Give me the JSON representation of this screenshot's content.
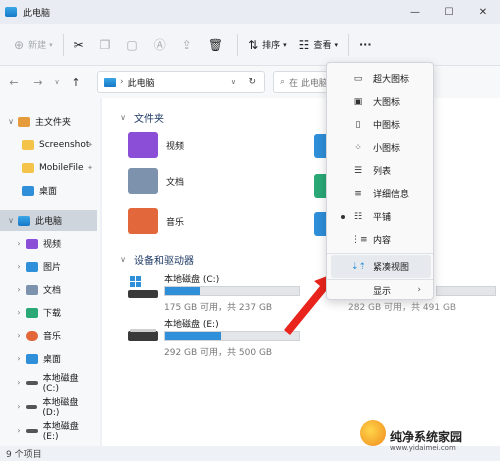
{
  "window": {
    "title": "此电脑"
  },
  "toolbar": {
    "new_label": "新建",
    "sort_label": "排序",
    "view_label": "查看",
    "more_label": "···"
  },
  "address": {
    "path": "此电脑"
  },
  "search": {
    "placeholder": "在 此电脑"
  },
  "sidebar": {
    "items": [
      {
        "label": "主文件夹"
      },
      {
        "label": "Screenshot"
      },
      {
        "label": "MobileFile"
      },
      {
        "label": "桌面"
      },
      {
        "label": "此电脑"
      },
      {
        "label": "视频"
      },
      {
        "label": "图片"
      },
      {
        "label": "文档"
      },
      {
        "label": "下载"
      },
      {
        "label": "音乐"
      },
      {
        "label": "桌面"
      },
      {
        "label": "本地磁盘 (C:)"
      },
      {
        "label": "本地磁盘 (D:)"
      },
      {
        "label": "本地磁盘 (E:)"
      }
    ]
  },
  "content": {
    "folders_title": "文件夹",
    "folders": [
      {
        "label": "视频"
      },
      {
        "label": "文档"
      },
      {
        "label": "音乐"
      }
    ],
    "devices_title": "设备和驱动器",
    "drives": [
      {
        "name": "本地磁盘 (C:)",
        "free": "175 GB 可用，共 237 GB",
        "used_fraction": 0.26
      },
      {
        "name": "本地磁盘 (E:)",
        "free": "292 GB 可用，共 500 GB",
        "used_fraction": 0.42
      }
    ],
    "partial_drive_free": "282 GB 可用，共 491 GB"
  },
  "view_menu": {
    "items": [
      {
        "label": "超大图标"
      },
      {
        "label": "大图标"
      },
      {
        "label": "中图标"
      },
      {
        "label": "小图标"
      },
      {
        "label": "列表"
      },
      {
        "label": "详细信息"
      },
      {
        "label": "平铺"
      },
      {
        "label": "内容"
      },
      {
        "label": "紧凑视图"
      },
      {
        "label": "显示"
      }
    ],
    "selected": "平铺"
  },
  "status": {
    "count": "9 个项目"
  },
  "watermark": {
    "text1": "纯净系统家园",
    "text2": "www.yidaimei.com"
  },
  "colors": {
    "accent": "#2f8fd8",
    "arrow": "#e8241c"
  }
}
